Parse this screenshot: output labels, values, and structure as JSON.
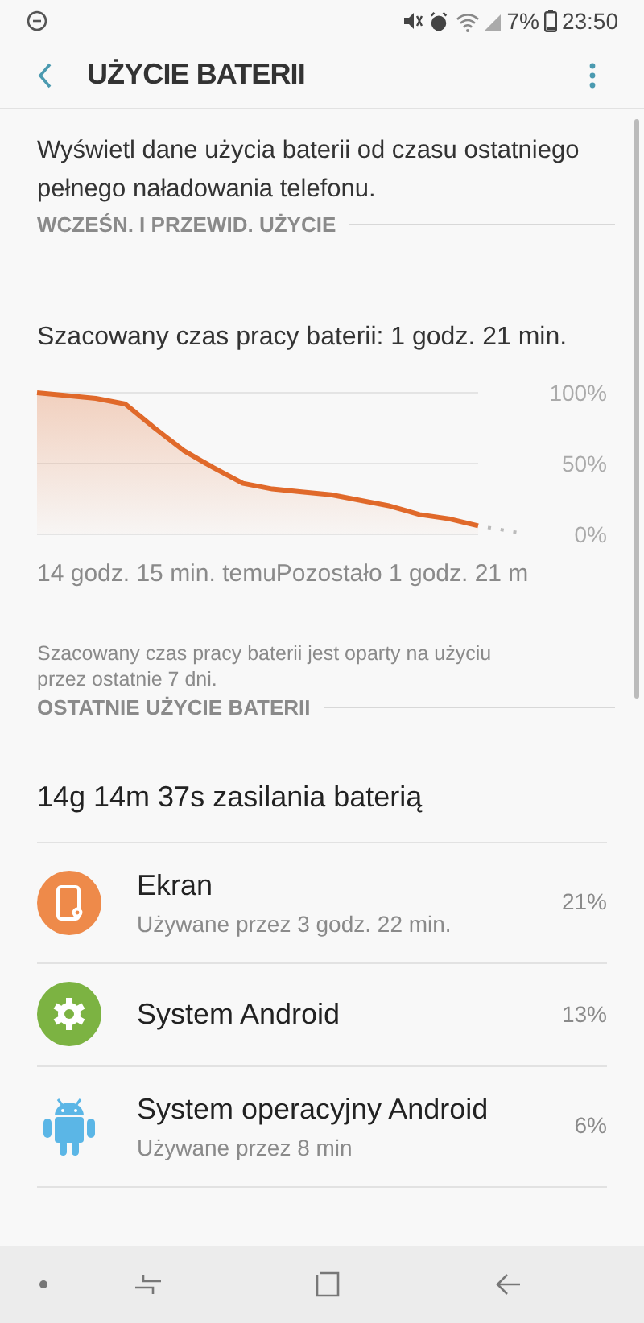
{
  "status_bar": {
    "time": "23:50",
    "battery": "7%"
  },
  "header": {
    "title": "UŻYCIE BATERII"
  },
  "description": "Wyświetl dane użycia baterii od czasu ostatniego pełnego naładowania telefonu.",
  "sections": [
    {
      "title": "WCZEŚN. I PRZEWID. UŻYCIE"
    },
    {
      "title": "OSTATNIE UŻYCIE BATERII"
    }
  ],
  "estimate": "Szacowany czas pracy baterii: 1 godz. 21 min.",
  "chart": {
    "start_label": "14 godz. 15 min. temu",
    "end_label": "Pozostało 1 godz. 21 m",
    "chart_data": {
      "type": "area",
      "ylim": [
        0,
        100
      ],
      "yticks": [
        {
          "value": 100,
          "label": "100%"
        },
        {
          "value": 50,
          "label": "50%"
        },
        {
          "value": 0,
          "label": "0%"
        }
      ],
      "series": [
        {
          "color": "#e0692a",
          "values": [
            100,
            98,
            96,
            92,
            75,
            59,
            47,
            36,
            32,
            30,
            28,
            24,
            20,
            14,
            11,
            6
          ]
        }
      ]
    }
  },
  "footnote": "Szacowany czas pracy baterii jest oparty na użyciu przez ostatnie 7 dni.",
  "total": "14g 14m 37s zasilania baterią",
  "apps": [
    {
      "kind": "screen",
      "name": "Ekran",
      "detail": "Używane przez 3 godz. 22 min.",
      "percent": "21%"
    },
    {
      "kind": "system",
      "name": "System Android",
      "percent": "13%"
    },
    {
      "kind": "android",
      "name": "System operacyjny Android",
      "detail": "Używane przez 8 min",
      "percent": "6%"
    }
  ]
}
